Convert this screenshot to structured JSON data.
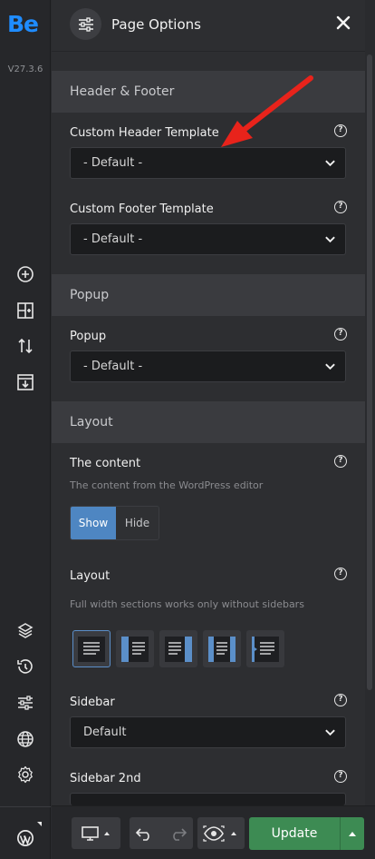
{
  "app": {
    "logo": "Be",
    "version": "V27.3.6"
  },
  "panel": {
    "title": "Page Options"
  },
  "sections": {
    "header_footer": "Header & Footer",
    "popup": "Popup",
    "layout": "Layout"
  },
  "fields": {
    "custom_header": {
      "label": "Custom Header Template",
      "value": "- Default -"
    },
    "custom_footer": {
      "label": "Custom Footer Template",
      "value": "- Default -"
    },
    "popup": {
      "label": "Popup",
      "value": "- Default -"
    },
    "content": {
      "label": "The content",
      "desc": "The content from the WordPress editor",
      "options": [
        "Show",
        "Hide"
      ],
      "selected": "Show"
    },
    "layout": {
      "label": "Layout",
      "desc": "Full width sections works only without sidebars"
    },
    "sidebar": {
      "label": "Sidebar",
      "value": "Default"
    },
    "sidebar2": {
      "label": "Sidebar 2nd"
    }
  },
  "help_glyph": "?",
  "footer": {
    "update_label": "Update"
  },
  "colors": {
    "accent": "#1f8cff",
    "update": "#3d8b53",
    "active": "#4e86c2",
    "arrow": "#e8231b"
  }
}
